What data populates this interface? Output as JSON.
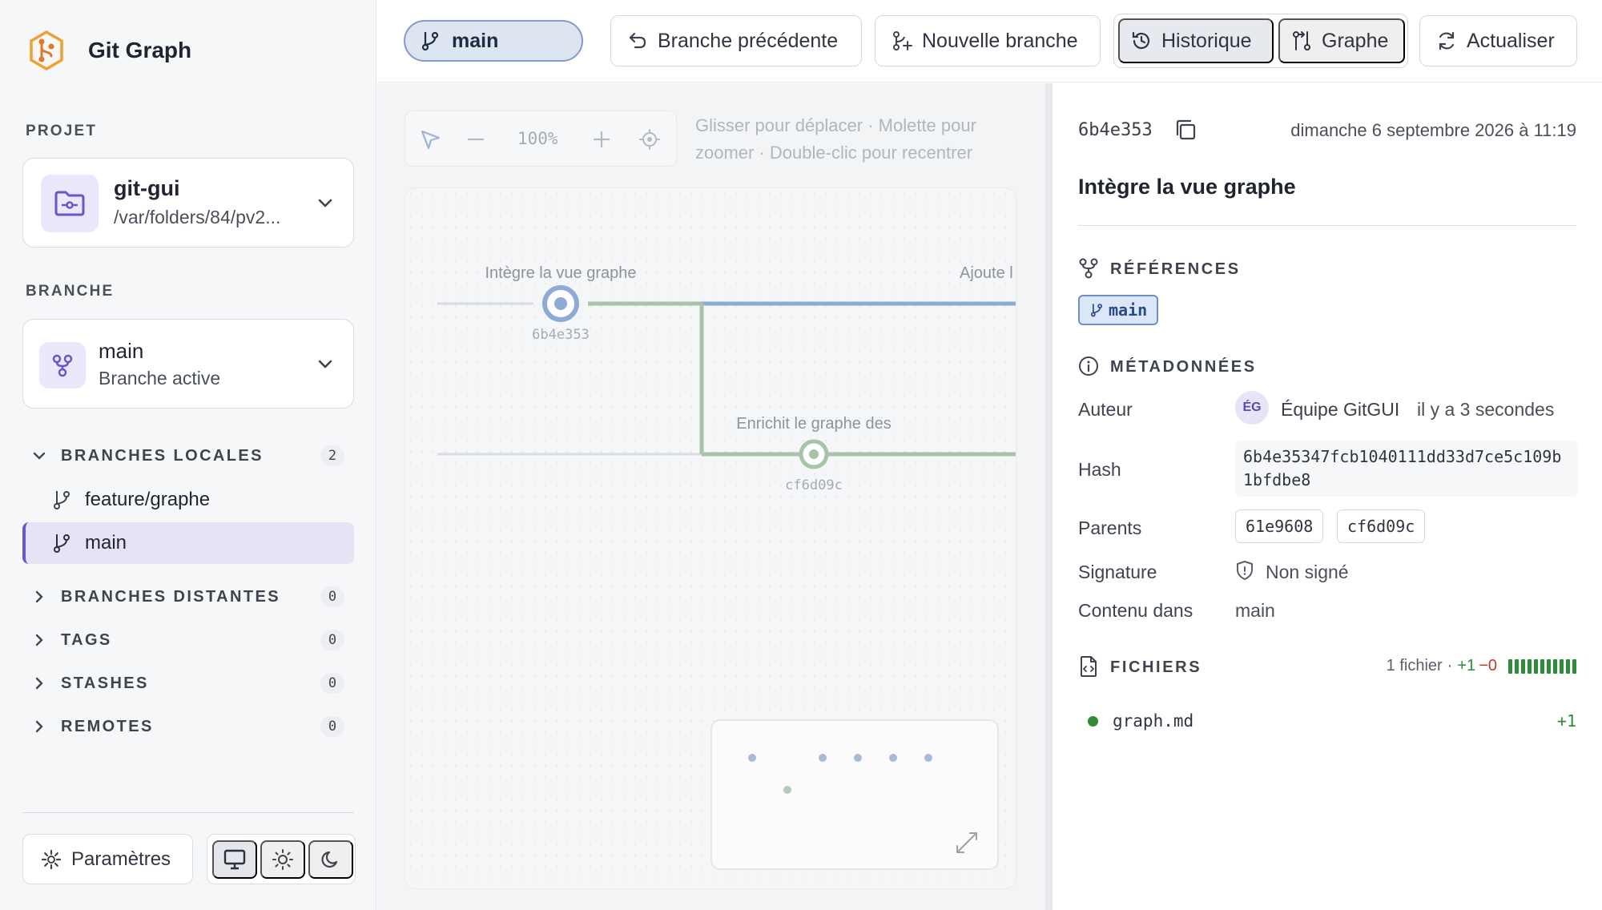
{
  "app": {
    "title": "Git Graph"
  },
  "sidebar": {
    "project_label": "PROJET",
    "project": {
      "name": "git-gui",
      "path": "/var/folders/84/pv2..."
    },
    "branch_label": "BRANCHE",
    "branch": {
      "name": "main",
      "status": "Branche active"
    },
    "groups": [
      {
        "label": "BRANCHES LOCALES",
        "count": "2",
        "expanded": true
      },
      {
        "label": "BRANCHES DISTANTES",
        "count": "0",
        "expanded": false
      },
      {
        "label": "TAGS",
        "count": "0",
        "expanded": false
      },
      {
        "label": "STASHES",
        "count": "0",
        "expanded": false
      },
      {
        "label": "REMOTES",
        "count": "0",
        "expanded": false
      }
    ],
    "local_branches": [
      {
        "name": "feature/graphe",
        "active": false
      },
      {
        "name": "main",
        "active": true
      }
    ],
    "settings_label": "Paramètres",
    "theme_options": [
      "monitor-icon",
      "sun-icon",
      "moon-icon"
    ],
    "theme_selected": "monitor-icon"
  },
  "toolbar": {
    "current_branch": "main",
    "previous_branch_label": "Branche précédente",
    "new_branch_label": "Nouvelle branche",
    "history_label": "Historique",
    "graph_label": "Graphe",
    "view_selected": "history",
    "refresh_label": "Actualiser"
  },
  "graph": {
    "zoom_level": "100%",
    "hint": "Glisser pour déplacer · Molette pour zoomer · Double-clic pour recentrer",
    "commits": [
      {
        "message": "Intègre la vue graphe",
        "hash": "6b4e353",
        "selected": true
      },
      {
        "message": "Enrichit le graphe des",
        "hash": "cf6d09c",
        "selected": false
      },
      {
        "message": "Ajoute l",
        "hash": "",
        "selected": false
      }
    ]
  },
  "details": {
    "hash_short": "6b4e353",
    "date": "dimanche 6 septembre 2026 à 11:19",
    "title": "Intègre la vue graphe",
    "references_label": "RÉFÉRENCES",
    "refs": [
      "main"
    ],
    "metadata_label": "MÉTADONNÉES",
    "author_label": "Auteur",
    "author_initials": "ÉG",
    "author_name": "Équipe GitGUI",
    "author_time": "il y a 3 secondes",
    "hash_label": "Hash",
    "hash_full": "6b4e35347fcb1040111dd33d7ce5c109b1bfdbe8",
    "parents_label": "Parents",
    "parents": [
      "61e9608",
      "cf6d09c"
    ],
    "signature_label": "Signature",
    "signature_value": "Non signé",
    "contained_label": "Contenu dans",
    "contained_value": "main",
    "files_label": "FICHIERS",
    "files_count": "1 fichier",
    "files_separator": "·",
    "additions": "+1",
    "deletions": "−0",
    "files": [
      {
        "name": "graph.md",
        "additions": "+1",
        "status_color": "#2e8b3a"
      }
    ]
  },
  "colors": {
    "accent": "#6a56c8",
    "branch_main": "#8eabd6",
    "branch_feature": "#a7c4aa",
    "added": "#2e8b3a",
    "deleted": "#c0392b"
  }
}
